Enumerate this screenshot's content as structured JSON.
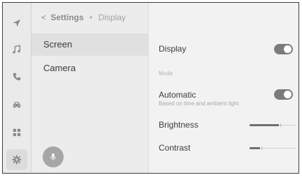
{
  "breadcrumb": {
    "current": "Settings",
    "separator": "•",
    "leaf": "Display"
  },
  "submenu": {
    "items": [
      {
        "label": "Screen"
      },
      {
        "label": "Camera"
      }
    ]
  },
  "rail": {
    "icons": [
      "navigation-arrow-icon",
      "music-note-icon",
      "phone-icon",
      "car-icon",
      "apps-grid-icon",
      "settings-gear-icon"
    ],
    "active": "settings-gear-icon"
  },
  "detail": {
    "display": {
      "label": "Display",
      "on": true
    },
    "mode_section": "Mode",
    "automatic": {
      "label": "Automatic",
      "sub": "Based on time and ambient light",
      "on": true
    },
    "brightness": {
      "label": "Brightness",
      "level": 0.62
    },
    "contrast": {
      "label": "Contrast",
      "level": 0.23
    }
  },
  "colors": {
    "toggle_on": "#7b7b7b",
    "slider_fill": "#6f6f6f",
    "text": "#3c3c3c",
    "muted": "#a8a8a8"
  }
}
